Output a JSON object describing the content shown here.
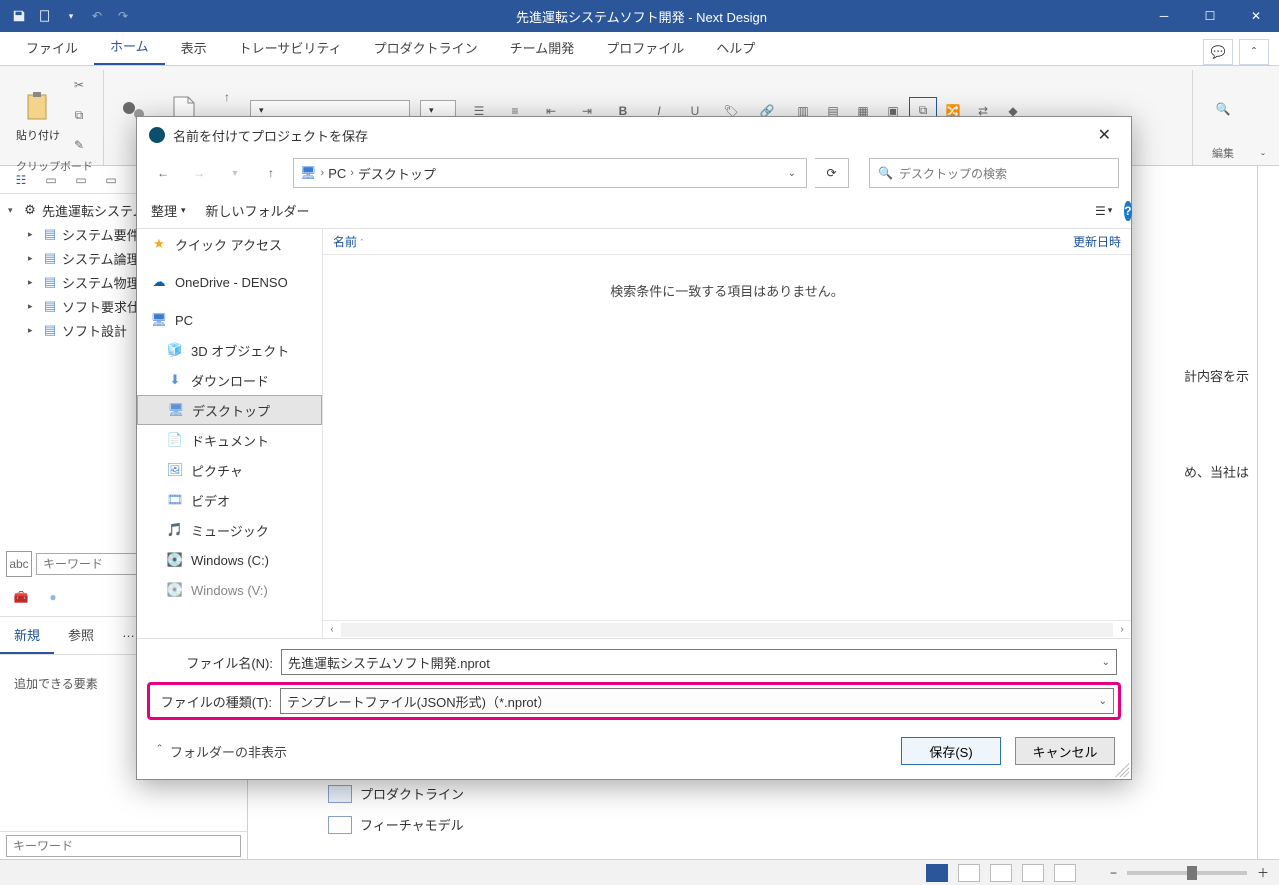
{
  "app": {
    "title": "先進運転システムソフト開発 - Next Design"
  },
  "ribbon": {
    "tabs": [
      "ファイル",
      "ホーム",
      "表示",
      "トレーサビリティ",
      "プロダクトライン",
      "チーム開発",
      "プロファイル",
      "ヘルプ"
    ],
    "active_tab": "ホーム",
    "group_clipboard": "クリップボード",
    "paste": "貼り付け",
    "group_edit": "編集"
  },
  "nav": {
    "root": "先進運転システム",
    "items": [
      "システム要件",
      "システム論理",
      "システム物理",
      "ソフト要求仕様",
      "ソフト設計"
    ],
    "search_placeholder": "キーワード",
    "tabs": [
      "新規",
      "参照"
    ],
    "active_tab": "新規",
    "empty_msg": "追加できる要素",
    "bottom_search_placeholder": "キーワード"
  },
  "center": {
    "text_right1": "計内容を示",
    "text_right2": "め、当社は",
    "row1": "プロダクトライン",
    "row2": "フィーチャモデル"
  },
  "dialog": {
    "title": "名前を付けてプロジェクトを保存",
    "crumb": [
      "PC",
      "デスクトップ"
    ],
    "search_placeholder": "デスクトップの検索",
    "toolbar_organize": "整理",
    "toolbar_newfolder": "新しいフォルダー",
    "tree": {
      "quick": "クイック アクセス",
      "onedrive": "OneDrive - DENSO",
      "pc": "PC",
      "pc_children": [
        "3D オブジェクト",
        "ダウンロード",
        "デスクトップ",
        "ドキュメント",
        "ピクチャ",
        "ビデオ",
        "ミュージック",
        "Windows (C:)",
        "Windows (V:)"
      ],
      "selected": "デスクトップ"
    },
    "list": {
      "col_name": "名前",
      "col_date": "更新日時",
      "empty": "検索条件に一致する項目はありません。"
    },
    "filename_label": "ファイル名(N):",
    "filename_value": "先進運転システムソフト開発.nprot",
    "filetype_label": "ファイルの種類(T):",
    "filetype_value": "テンプレートファイル(JSON形式)（*.nprot）",
    "hide_folders": "フォルダーの非表示",
    "save": "保存(S)",
    "cancel": "キャンセル"
  }
}
